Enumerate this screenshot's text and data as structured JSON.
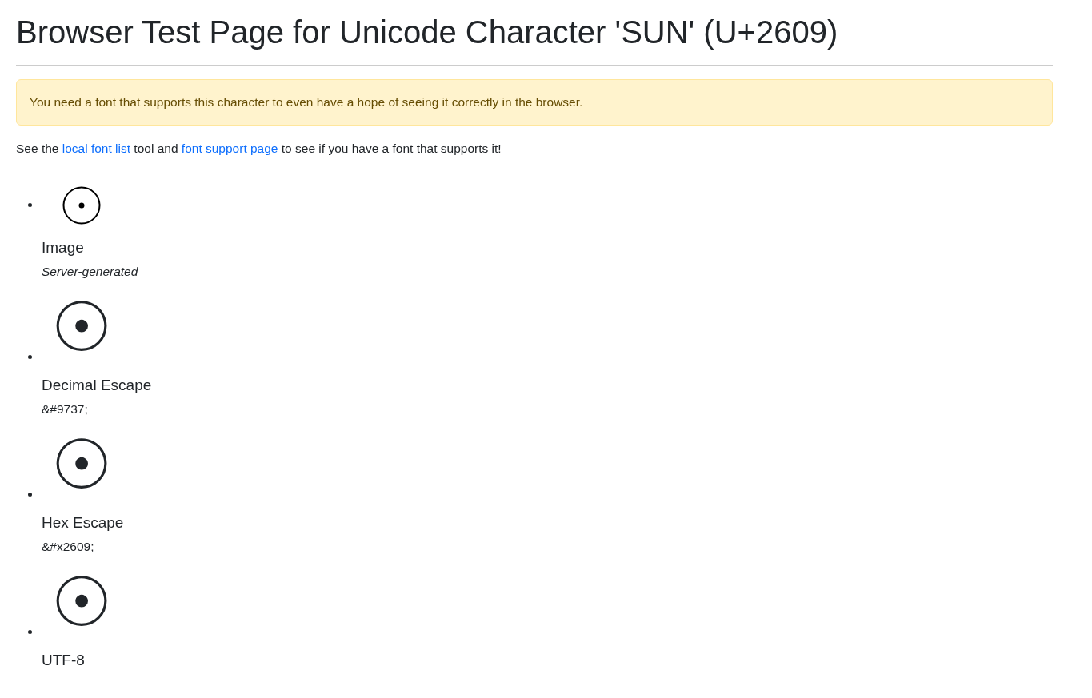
{
  "title": "Browser Test Page for Unicode Character 'SUN' (U+2609)",
  "alert": "You need a font that supports this character to even have a hope of seeing it correctly in the browser.",
  "intro": {
    "before": "See the ",
    "link_1": "local font list",
    "middle": " tool and ",
    "link_2": "font support page",
    "after": " to see if you have a font that supports it!"
  },
  "items": [
    {
      "kind": "image",
      "label": "Image",
      "note": "Server-generated",
      "note_italic": true
    },
    {
      "kind": "glyph",
      "glyph": "☉",
      "label": "Decimal Escape",
      "note": "&#9737;",
      "note_italic": false
    },
    {
      "kind": "glyph",
      "glyph": "☉",
      "label": "Hex Escape",
      "note": "&#x2609;",
      "note_italic": false
    },
    {
      "kind": "glyph",
      "glyph": "☉",
      "label": "UTF-8"
    }
  ]
}
